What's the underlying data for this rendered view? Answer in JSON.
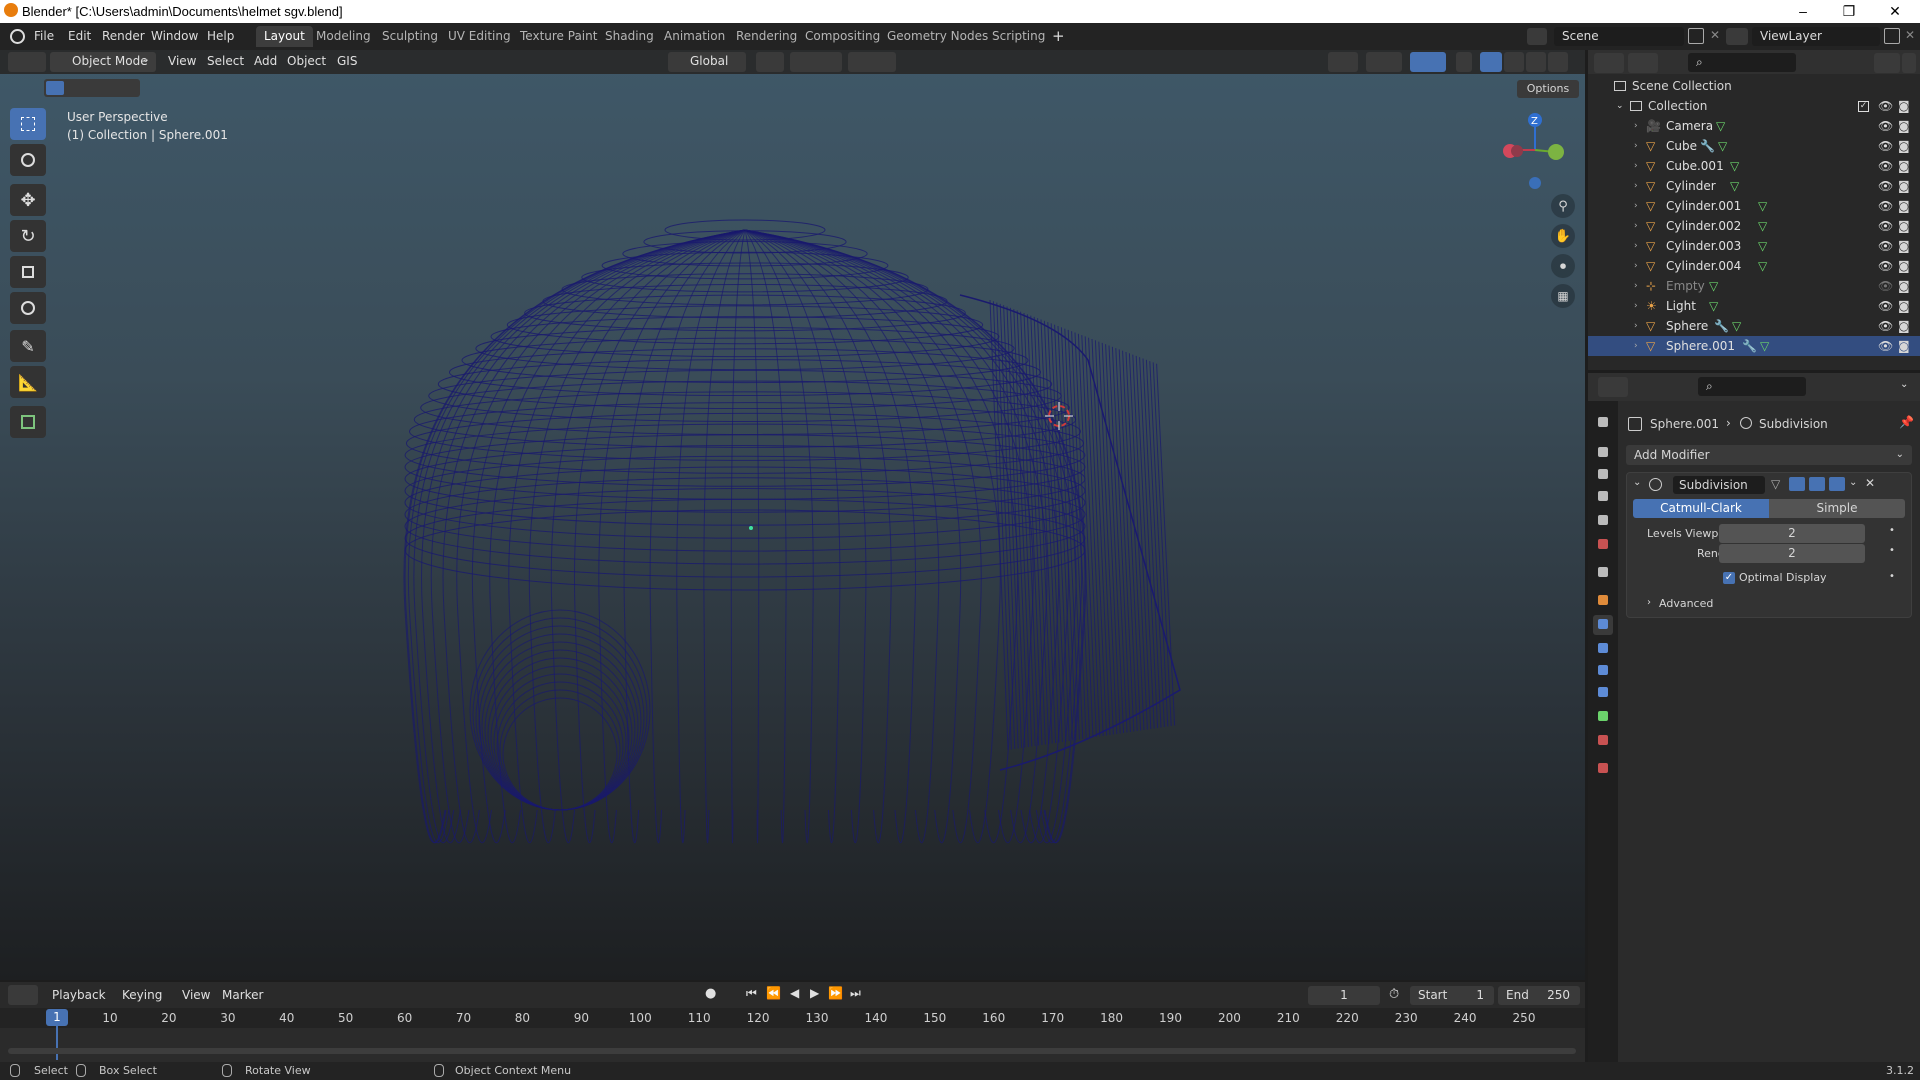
{
  "window": {
    "title": "Blender* [C:\\Users\\admin\\Documents\\helmet sgv.blend]",
    "minimize": "–",
    "restore": "❐",
    "close": "✕"
  },
  "menubar": {
    "items": [
      "File",
      "Edit",
      "Render",
      "Window",
      "Help"
    ],
    "workspaces": [
      "Layout",
      "Modeling",
      "Sculpting",
      "UV Editing",
      "Texture Paint",
      "Shading",
      "Animation",
      "Rendering",
      "Compositing",
      "Geometry Nodes",
      "Scripting"
    ],
    "active_workspace": "Layout",
    "add_tab": "+",
    "scene": "Scene",
    "view_layer": "ViewLayer"
  },
  "viewport_header": {
    "mode": "Object Mode",
    "menus": [
      "View",
      "Select",
      "Add",
      "Object",
      "GIS"
    ],
    "transform_orientation": "Global",
    "options": "Options"
  },
  "viewport": {
    "perspective": "User Perspective",
    "collection_info": "(1) Collection | Sphere.001",
    "gizmo_z": "Z"
  },
  "outliner": {
    "root": "Scene Collection",
    "collection": "Collection",
    "items": [
      {
        "name": "Camera",
        "type": "camera"
      },
      {
        "name": "Cube",
        "type": "mesh-mod"
      },
      {
        "name": "Cube.001",
        "type": "mesh"
      },
      {
        "name": "Cylinder",
        "type": "mesh"
      },
      {
        "name": "Cylinder.001",
        "type": "mesh"
      },
      {
        "name": "Cylinder.002",
        "type": "mesh"
      },
      {
        "name": "Cylinder.003",
        "type": "mesh"
      },
      {
        "name": "Cylinder.004",
        "type": "mesh"
      },
      {
        "name": "Empty",
        "type": "empty"
      },
      {
        "name": "Light",
        "type": "light"
      },
      {
        "name": "Sphere",
        "type": "mesh-mod"
      },
      {
        "name": "Sphere.001",
        "type": "mesh-mod"
      }
    ]
  },
  "properties": {
    "breadcrumb_object": "Sphere.001",
    "breadcrumb_modifier": "Subdivision",
    "add_modifier": "Add Modifier",
    "modifier_name": "Subdivision",
    "method_catmull": "Catmull-Clark",
    "method_simple": "Simple",
    "levels_viewport_label": "Levels Viewport",
    "levels_viewport": "2",
    "render_label": "Render",
    "render": "2",
    "optimal_display": "Optimal Display",
    "advanced": "Advanced"
  },
  "timeline": {
    "menus": [
      "Playback",
      "Keying",
      "View",
      "Marker"
    ],
    "current_frame": "1",
    "start_label": "Start",
    "start": "1",
    "end_label": "End",
    "end": "250",
    "ticks": [
      "1",
      "10",
      "20",
      "30",
      "40",
      "50",
      "60",
      "70",
      "80",
      "90",
      "100",
      "110",
      "120",
      "130",
      "140",
      "150",
      "160",
      "170",
      "180",
      "190",
      "200",
      "210",
      "220",
      "230",
      "240",
      "250"
    ]
  },
  "statusbar": {
    "select": "Select",
    "box_select": "Box Select",
    "rotate_view": "Rotate View",
    "context_menu": "Object Context Menu",
    "version": "3.1.2"
  },
  "colors": {
    "accent": "#4772b3",
    "wire": "#1a1a6e",
    "mesh_icon": "#e8a24a",
    "vertex_icon": "#6bd36b"
  }
}
